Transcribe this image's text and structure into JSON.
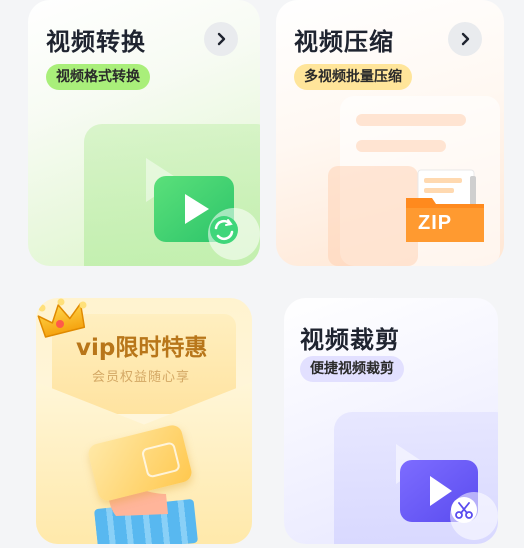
{
  "cards": {
    "convert": {
      "title": "视频转换",
      "tag": "视频格式转换",
      "tag_color": "#a9ef7a",
      "icon": "video-convert-icon",
      "icon_color": "#3fd67a"
    },
    "compress": {
      "title": "视频压缩",
      "tag": "多视频批量压缩",
      "tag_color": "#ffe59a",
      "icon": "zip-folder-icon",
      "icon_label": "ZIP",
      "icon_color": "#ff8a1e"
    },
    "vip": {
      "title": "vip限时特惠",
      "subtitle": "会员权益随心享",
      "icon": "crown-icon",
      "accent": "#b8761a"
    },
    "crop": {
      "title": "视频裁剪",
      "tag": "便捷视频裁剪",
      "tag_color": "#e2e0ff",
      "icon": "video-crop-icon",
      "icon_color": "#6c5cf5"
    }
  },
  "icons": {
    "arrow": "chevron-right-icon"
  }
}
